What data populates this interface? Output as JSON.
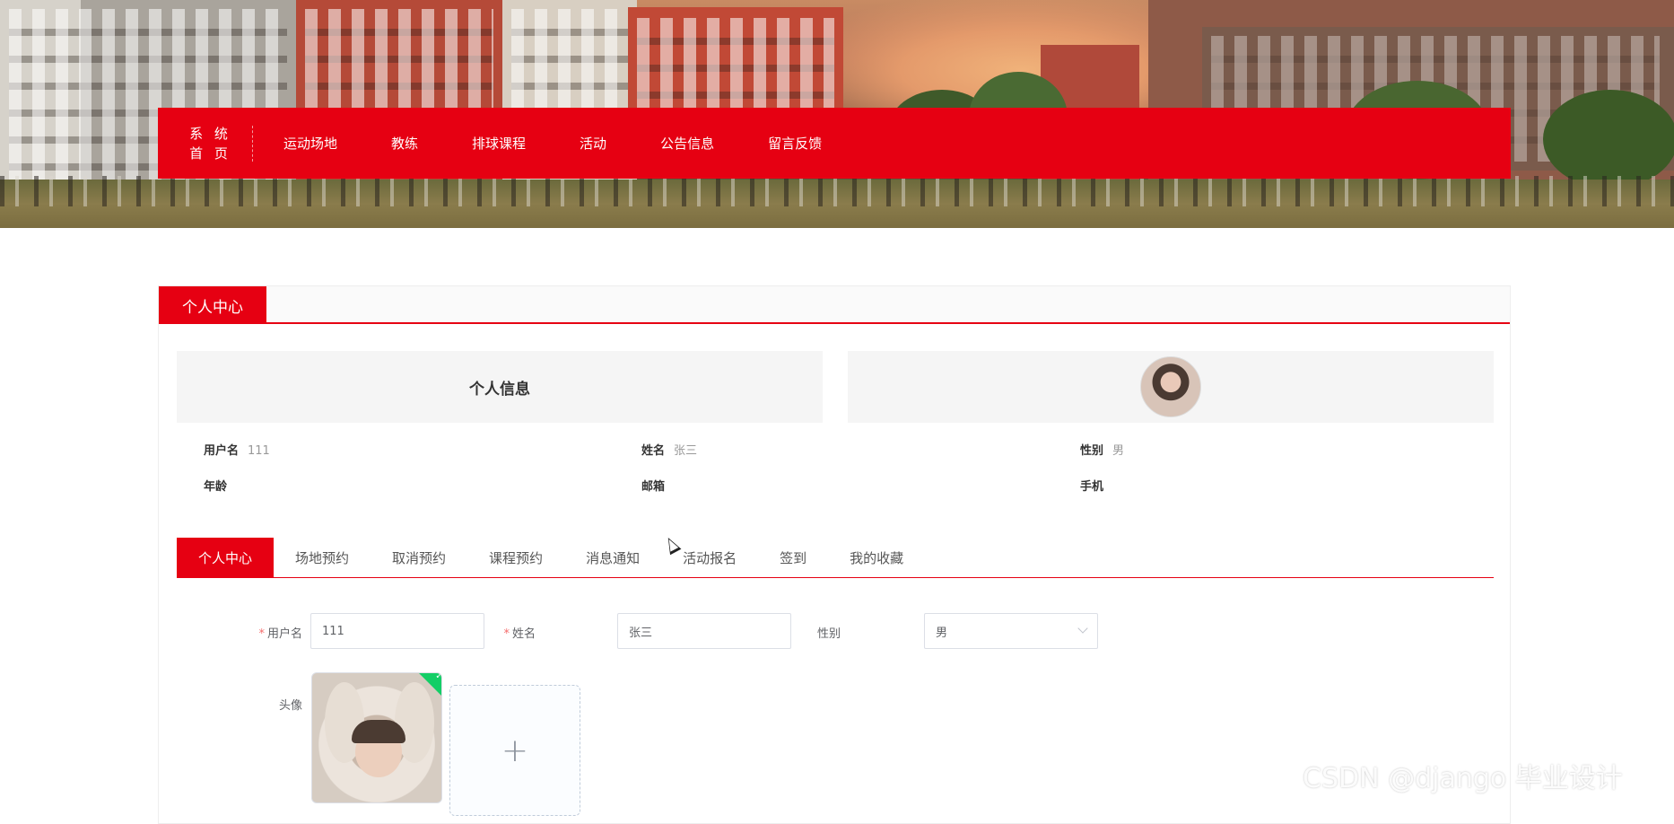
{
  "nav": {
    "home_line1": "系 统",
    "home_line2": "首 页",
    "items": [
      "运动场地",
      "教练",
      "排球课程",
      "活动",
      "公告信息",
      "留言反馈"
    ]
  },
  "panel": {
    "title": "个人中心",
    "info_title": "个人信息",
    "fields": {
      "username_label": "用户名",
      "username_value": "111",
      "name_label": "姓名",
      "name_value": "张三",
      "gender_label": "性别",
      "gender_value": "男",
      "age_label": "年龄",
      "age_value": "",
      "email_label": "邮箱",
      "email_value": "",
      "phone_label": "手机",
      "phone_value": ""
    }
  },
  "tabs": [
    "个人中心",
    "场地预约",
    "取消预约",
    "课程预约",
    "消息通知",
    "活动报名",
    "签到",
    "我的收藏"
  ],
  "form": {
    "username_label": "用户名",
    "username_value": "111",
    "name_label": "姓名",
    "name_value": "张三",
    "gender_label": "性别",
    "gender_value": "男",
    "avatar_label": "头像",
    "required_mark": "*",
    "upload_plus": "+"
  },
  "watermark": "CSDN @django 毕业设计",
  "colors": {
    "accent": "#e60012",
    "upload_success": "#13ce66"
  }
}
